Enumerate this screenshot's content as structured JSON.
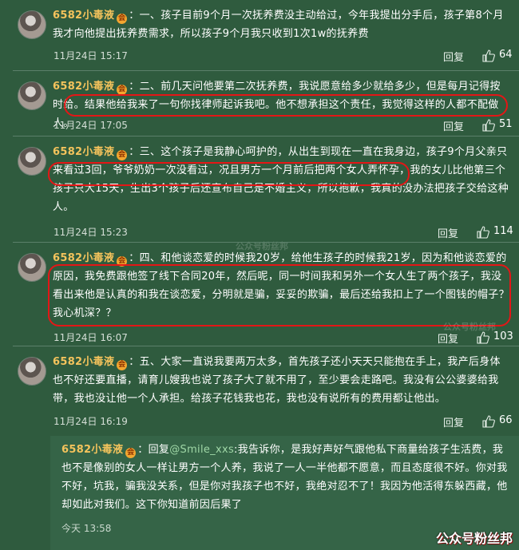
{
  "comments": [
    {
      "username": "6582小毒液",
      "text": "一、孩子目前9个月一次抚养费没主动给过，今年我提出分手后，孩子第8个月我才向他提出抚养费需求，所以孩子9个月我只收到1次1w的抚养费",
      "time": "11月24日 15:17",
      "reply": "回复",
      "likes": "64"
    },
    {
      "username": "6582小毒液",
      "text": "二、前几天问他要第二次抚养费，我说愿意给多少就给多少，但是每月记得按时给。结果他给我来了一句你找律师起诉我吧。他不想承担这个责任，我觉得这样的人都不配做人。",
      "time": "11月24日 17:05",
      "reply": "回复",
      "likes": "51"
    },
    {
      "username": "6582小毒液",
      "text": "三、这个孩子是我静心呵护的，从出生到现在一直在我身边，孩子9个月父亲只来看过3回，爷爷奶奶一次没看过，况且男方一个月前后把两个女人弄怀孕，我的女儿比他第三个孩子只大15天，生出3个孩子后还宣布自己是不婚主义，所以抱歉，我真的没办法把孩子交给这种人。",
      "time": "11月24日 15:23",
      "reply": "回复",
      "likes": "114"
    },
    {
      "username": "6582小毒液",
      "text": "四、和他谈恋爱的时候我20岁，给他生孩子的时候我21岁，因为和他谈恋爱的原因，我免费跟他签了线下合同20年，然后呢，同一时间我和另外一个女人生了两个孩子，我没看出来他是认真的和我在谈恋爱，分明就是骗，妥妥的欺骗，最后还给我扣上了一个图钱的帽子？我心机深？？",
      "time": "11月24日 16:07",
      "reply": "回复",
      "likes": "103"
    },
    {
      "username": "6582小毒液",
      "text": "五、大家一直说我要两万太多，首先孩子还小天天只能抱在手上，我产后身体也不好还要直播，请育儿嫂我也说了孩子大了就不用了，至少要会走路吧。我没有公公婆婆给我带，我也没让他一个人承担。给孩子花钱我也花，我也没有说所有的费用都让他出。",
      "time": "11月24日 16:19",
      "reply": "回复",
      "likes": "66"
    }
  ],
  "nested_reply": {
    "username": "6582小毒液",
    "prefix": "回复",
    "mention": "@Smile_xxs",
    "text": ":我告诉你，是我好声好气跟他私下商量给孩子生活费，我也不是像别的女人一样让男方一个人养，我说了一人一半他都不愿意，而且态度很不好。你对我不好，坑我，骗我没关系，但是你对我孩子也不好，我绝对忍不了！我因为他活得东躲西藏，他却如此对我们。这下你知道前因后果了",
    "time": "今天 13:58"
  },
  "watermarks": [
    "公众号粉丝邦",
    "公众号粉丝邦",
    "公众号粉丝邦"
  ],
  "colors": {
    "background": "#2f5b3e",
    "username": "#f4c35c",
    "highlight": "#e41616"
  }
}
